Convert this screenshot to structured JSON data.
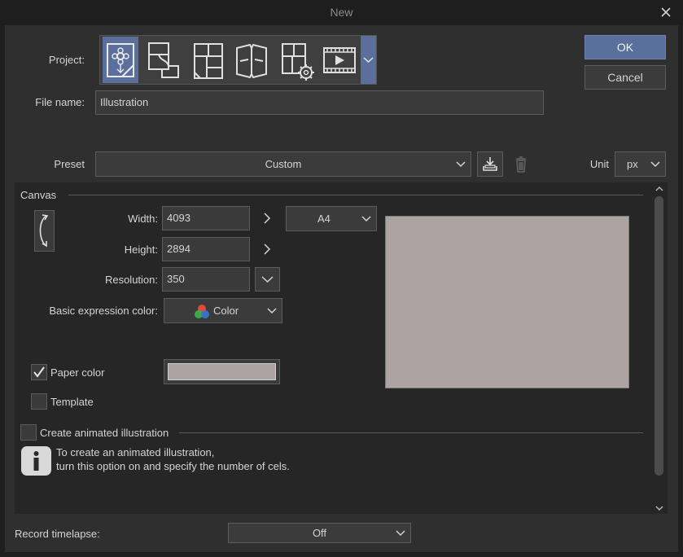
{
  "window": {
    "title": "New"
  },
  "project": {
    "label": "Project:",
    "types": [
      {
        "icon": "illustration-icon",
        "selected": true
      },
      {
        "icon": "webtoon-icon",
        "selected": false
      },
      {
        "icon": "comic-icon",
        "selected": false
      },
      {
        "icon": "fanzine-icon",
        "selected": false
      },
      {
        "icon": "comic-settings-icon",
        "selected": false
      },
      {
        "icon": "animation-icon",
        "selected": false
      }
    ]
  },
  "file_name": {
    "label": "File name:",
    "value": "Illustration"
  },
  "buttons": {
    "ok": "OK",
    "cancel": "Cancel"
  },
  "preset": {
    "label": "Preset",
    "value": "Custom"
  },
  "unit": {
    "label": "Unit",
    "value": "px"
  },
  "canvas": {
    "section_label": "Canvas",
    "width_label": "Width:",
    "width_value": "4093",
    "height_label": "Height:",
    "height_value": "2894",
    "size_preset": "A4",
    "resolution_label": "Resolution:",
    "resolution_value": "350",
    "expression_color_label": "Basic expression color:",
    "expression_color_value": "Color",
    "paper_color_label": "Paper color",
    "paper_color_checked": true,
    "paper_color_hex": "#aea3a3",
    "template_label": "Template",
    "template_checked": false
  },
  "animation": {
    "label": "Create animated illustration",
    "checked": false,
    "info_line1": "To create an animated illustration,",
    "info_line2": "turn this option on and specify the number of cels."
  },
  "timelapse": {
    "label": "Record timelapse:",
    "value": "Off"
  },
  "colors": {
    "accent": "#5a6f9c",
    "dialog_bg": "#2f2f2f",
    "panel_bg": "#262626"
  }
}
